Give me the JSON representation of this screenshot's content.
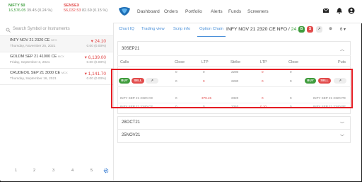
{
  "header": {
    "nifty": {
      "name": "NIFTY 50",
      "value": "16,576.05",
      "change": "39.45 (0.24 %)"
    },
    "sensex": {
      "name": "SENSEX",
      "value": "56,032.53",
      "change": "82.69 (0.15 %)"
    },
    "nav": [
      "Dashboard",
      "Orders",
      "Portfolio",
      "Alerts",
      "Funds",
      "Screeners"
    ],
    "icons": [
      "mail-icon",
      "bell-icon",
      "user-icon"
    ]
  },
  "watchlist": {
    "search_placeholder": "Search Symbol or Instruments",
    "items": [
      {
        "name": "INFY NOV 21 2320 CE",
        "exchange": "NFO",
        "date": "Thursday, November 25, 2021",
        "price": "24.10",
        "change": "0.00 (0.00%)"
      },
      {
        "name": "GOLDM SEP 21 41000 CE",
        "exchange": "MCX",
        "date": "Friday, September 3, 2021",
        "price": "6,139.00",
        "change": "0.00 (0.00%)"
      },
      {
        "name": "CRUDEOIL SEP 21 3000 CE",
        "exchange": "MCX",
        "date": "Thursday, September 16, 2021",
        "price": "1,141.70",
        "change": "0.00 (0.00%)"
      }
    ],
    "pages": [
      "1",
      "2",
      "3",
      "4",
      "5"
    ]
  },
  "tabs": [
    "Chart IQ",
    "Trading view",
    "Scrip info",
    "Option Chain"
  ],
  "instrument": {
    "title": "INFY NOV 21 2320 CE NFO",
    "price": "24.10",
    "buy": "B",
    "sell": "S",
    "qty": "6"
  },
  "option_chain": {
    "expiry_open": "30SEP21",
    "columns": [
      "Calls",
      "Close",
      "LTP",
      "Strike",
      "LTP",
      "Close",
      "Puts"
    ],
    "top_row": {
      "close": "0",
      "ltp": "0",
      "strike": "2280",
      "ltp2": "0",
      "close2": "0"
    },
    "hover_row": {
      "buy": "BUY",
      "sell": "SELL",
      "close": "0",
      "ltp": "0",
      "strike": "2280",
      "ltp2": "0",
      "close2": "0",
      "buy2": "BUY",
      "sell2": "SELL"
    },
    "rows": [
      {
        "call": "INFY SEP 21 2320 CE",
        "close": "0",
        "ltp": "379.45",
        "strike": "2320",
        "ltp2": "0",
        "close2": "0",
        "put": "INFY SEP 21 2320 PE"
      },
      {
        "call": "INFY SEP 21 2340 CE",
        "close": "0",
        "ltp": "0",
        "strike": "2340",
        "ltp2": "0.10",
        "close2": "0",
        "put": "INFY SEP 21 2340 PE"
      }
    ],
    "expiries_collapsed": [
      "28OCT21",
      "25NOV21"
    ]
  }
}
